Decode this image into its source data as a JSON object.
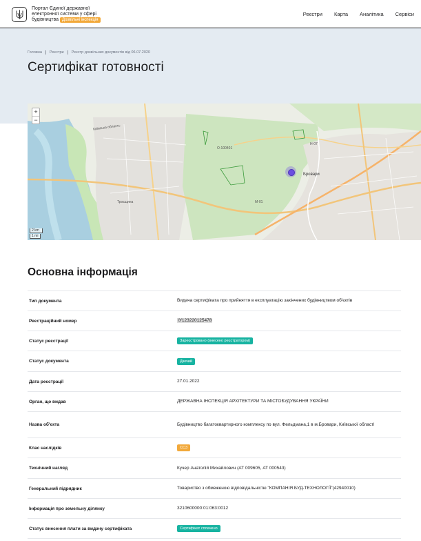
{
  "header": {
    "brand_lines": [
      "Портал Єдиної державної",
      "електронної системи у сфері",
      "будівництва"
    ],
    "brand_badge": "Дозвільні інспекція",
    "nav": [
      "Реєстри",
      "Карта",
      "Аналітика",
      "Сервіси"
    ]
  },
  "breadcrumbs": [
    "Головна",
    "Реєстри",
    "Реєстр дозвільних документів від 06.07.2020"
  ],
  "page_title": "Сертифікат готовності",
  "map": {
    "zoom_in": "+",
    "zoom_out": "−",
    "scale_km": "2 km",
    "scale_mi": "1 mi",
    "labels": [
      "Бровари",
      "Троєщина",
      "Київська область",
      "М-01",
      "Н-07",
      "О-100401"
    ]
  },
  "section_title": "Основна інформація",
  "rows": [
    {
      "label": "Тип документа",
      "value": "Видача сертифіката про прийняття в експлуатацію закінчених будівництвом об'єктів"
    },
    {
      "label": "Реєстраційний номер",
      "value": "IУ123220125478"
    },
    {
      "label": "Статус реєстрації",
      "value": "Зареєстровано (внесено реєстратором)"
    },
    {
      "label": "Статус документа",
      "value": "Діючий"
    },
    {
      "label": "Дата реєстрації",
      "value": "27.01.2022"
    },
    {
      "label": "Орган, що видав",
      "value": "ДЕРЖАВНА ІНСПЕКЦІЯ АРХІТЕКТУРИ ТА МІСТОБУДУВАННЯ УКРАЇНИ"
    },
    {
      "label": "Назва об'єкта",
      "value": "Будівництво багатоквартирного комплексу по вул. Фельдмана,1 в м.Бровари, Київської області"
    },
    {
      "label": "Клас наслідків",
      "value": "СС3"
    },
    {
      "label": "Технічний нагляд",
      "value": "Кучер Анатолій Михайлович (АТ 009605, АТ 000543)"
    },
    {
      "label": "Генеральний підрядник",
      "value": "Товариство з обмеженою відповідальністю \"КОМПАНІЯ БУД-ТЕХНОЛОГІЇ\"(42940010)"
    },
    {
      "label": "Інформація про земельну ділянку",
      "value": "3210600000:01:063:0012"
    },
    {
      "label": "Статус внесення плати за видачу сертифіката",
      "value": "Сертифікат сплачено"
    }
  ],
  "colors": {
    "accent_teal": "#17b3a1",
    "accent_amber": "#f2a93b",
    "hero_bg": "#e4ebf2",
    "marker": "#6c4fe0"
  }
}
